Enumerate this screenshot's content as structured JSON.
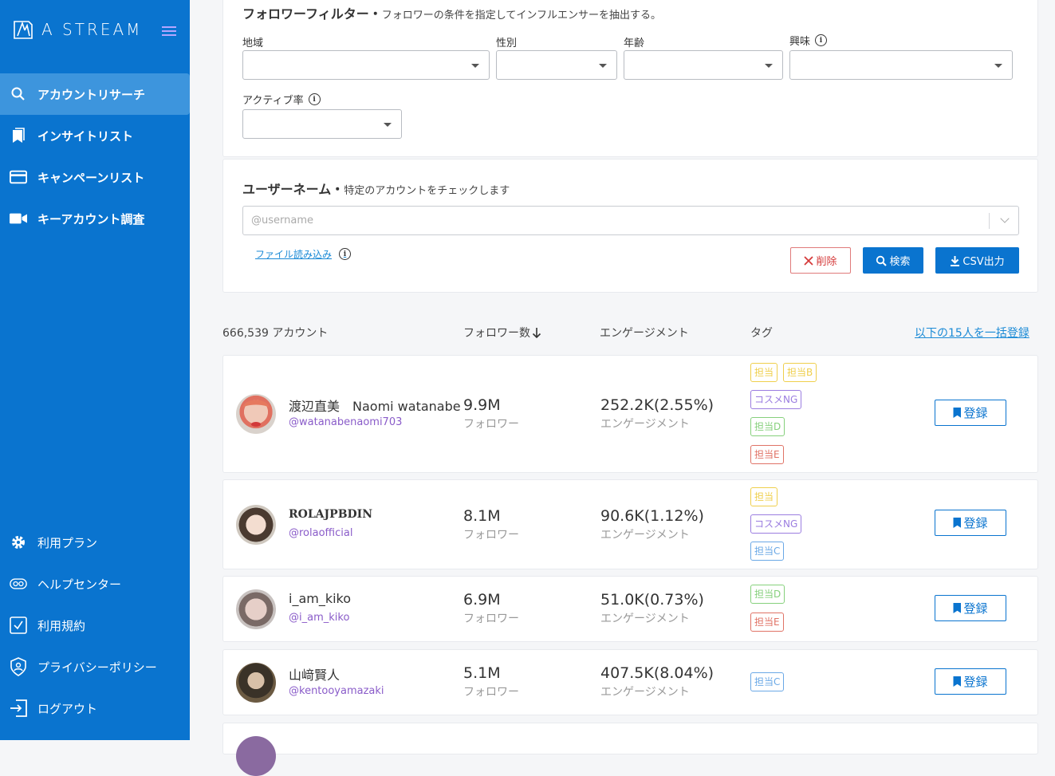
{
  "app": {
    "logo_text": "A STREAM"
  },
  "sidebar": {
    "items": [
      {
        "label": "アカウントリサーチ",
        "icon": "search-icon"
      },
      {
        "label": "インサイトリスト",
        "icon": "bookmark-icon"
      },
      {
        "label": "キャンペーンリスト",
        "icon": "card-icon"
      },
      {
        "label": "キーアカウント調査",
        "icon": "video-icon"
      }
    ],
    "bottom_items": [
      {
        "label": "利用プラン",
        "icon": "gear-icon"
      },
      {
        "label": "ヘルプセンター",
        "icon": "help-icon"
      },
      {
        "label": "利用規約",
        "icon": "checkbox-icon"
      },
      {
        "label": "プライバシーポリシー",
        "icon": "shield-icon"
      },
      {
        "label": "ログアウト",
        "icon": "logout-icon"
      }
    ]
  },
  "follower_filter": {
    "title": "フォロワーフィルター・",
    "subtitle": "フォロワーの条件を指定してインフルエンサーを抽出する。",
    "region_label": "地域",
    "gender_label": "性別",
    "age_label": "年齢",
    "interest_label": "興味",
    "active_rate_label": "アクティブ率"
  },
  "username": {
    "title": "ユーザーネーム・",
    "subtitle": "特定のアカウントをチェックします",
    "placeholder": "@username",
    "file_link": "ファイル読み込み",
    "delete_label": "削除",
    "search_label": "検索",
    "csv_label": "CSV出力"
  },
  "list": {
    "count_label": "666,539 アカウント",
    "followers_header": "フォロワー数",
    "engagement_header": "エンゲージメント",
    "tag_header": "タグ",
    "bulk_register": "以下の15人を一括登録",
    "follower_unit": "フォロワー",
    "engagement_unit": "エンゲージメント",
    "register_label": "登録",
    "rows": [
      {
        "name": "渡辺直美　Naomi watanabe",
        "handle": "@watanabenaomi703",
        "followers": "9.9M",
        "engagement": "252.2K(2.55%)",
        "tags": [
          "担当",
          "担当B",
          "コスメNG",
          "担当D",
          "担当E"
        ]
      },
      {
        "name": "ROLAJPBDIN",
        "handle": "@rolaofficial",
        "followers": "8.1M",
        "engagement": "90.6K(1.12%)",
        "tags": [
          "担当",
          "コスメNG",
          "担当C"
        ]
      },
      {
        "name": "i_am_kiko",
        "handle": "@i_am_kiko",
        "followers": "6.9M",
        "engagement": "51.0K(0.73%)",
        "tags": [
          "担当D",
          "担当E"
        ]
      },
      {
        "name": "山﨑賢人",
        "handle": "@kentooyamazaki",
        "followers": "5.1M",
        "engagement": "407.5K(8.04%)",
        "tags": [
          "担当C"
        ]
      }
    ]
  },
  "colors": {
    "sidebar": "#0a74cf",
    "accent": "#0a74cf",
    "handle": "#8a5cc9"
  }
}
